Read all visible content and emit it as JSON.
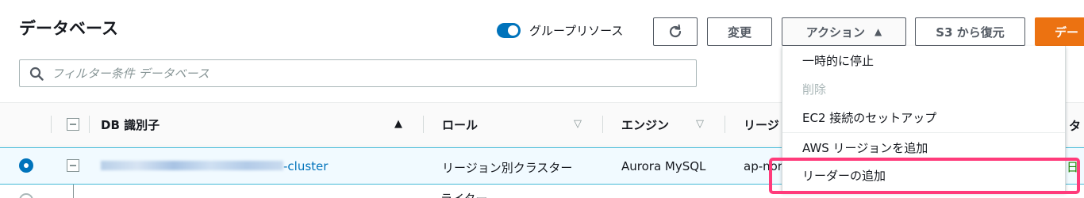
{
  "header": {
    "title": "データベース",
    "group_resources_label": "グループリソース",
    "modify_label": "変更",
    "actions_label": "アクション",
    "actions_caret": "▲",
    "restore_label": "S3 から復元",
    "create_label": "デー"
  },
  "filter": {
    "placeholder": "フィルター条件 データベース"
  },
  "table": {
    "columns": [
      {
        "label": "DB 識別子",
        "sort": "▲"
      },
      {
        "label": "ロール",
        "sort": "▽"
      },
      {
        "label": "エンジン",
        "sort": "▽"
      },
      {
        "label": "リージ"
      }
    ],
    "edge_header": "タ",
    "rows": [
      {
        "db_suffix": "-cluster",
        "role": "リージョン別クラスター",
        "engine": "Aurora MySQL",
        "region": "ap-nor",
        "edge_value": "日"
      },
      {
        "role": "ライター"
      }
    ]
  },
  "actions_menu": {
    "items": [
      {
        "label": "一時的に停止",
        "disabled": false
      },
      {
        "label": "削除",
        "disabled": true
      },
      {
        "label": "EC2 接続のセットアップ",
        "disabled": false
      },
      {
        "label": "AWS リージョンを追加",
        "disabled": false
      },
      {
        "label": "リーダーの追加",
        "disabled": false,
        "highlighted": true
      }
    ]
  },
  "colors": {
    "accent_blue": "#0073bb",
    "create_orange": "#ec7211",
    "highlight_pink": "#ff3b7b",
    "selected_row_bg": "#f1faff"
  }
}
